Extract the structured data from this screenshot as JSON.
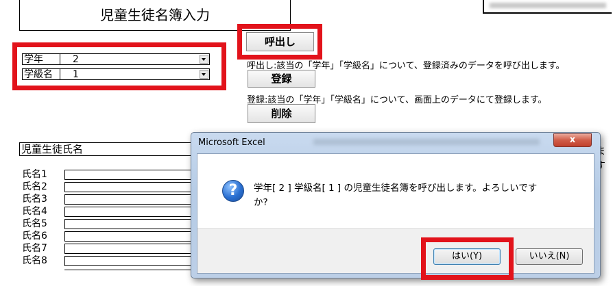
{
  "sheet": {
    "title": "児童生徒名簿入力",
    "fields": [
      {
        "label": "学年",
        "value": "2"
      },
      {
        "label": "学級名",
        "value": "1"
      }
    ],
    "buttons": {
      "call_label": "呼出し",
      "register_label": "登録",
      "delete_label": "削除"
    },
    "descriptions": {
      "call": "呼出し:該当の「学年」「学級名」について、登録済みのデータを呼び出します。",
      "register": "登録:該当の「学年」「学級名」について、画面上のデータにて登録します。"
    },
    "name_header": "児童生徒氏名",
    "right_cut": "ます",
    "name_rows": [
      "氏名1",
      "氏名2",
      "氏名3",
      "氏名4",
      "氏名5",
      "氏名6",
      "氏名7",
      "氏名8"
    ]
  },
  "dialog": {
    "title": "Microsoft Excel",
    "close_glyph": "x",
    "icon": "question-icon",
    "icon_glyph": "?",
    "message_line1": "学年[ 2 ] 学級名[ 1 ] の児童生徒名簿を呼び出します。よろしいです",
    "message_line2": "か?",
    "yes_label": "はい(Y)",
    "no_label": "いいえ(N)"
  },
  "colors": {
    "highlight_frame": "#e2131b"
  }
}
